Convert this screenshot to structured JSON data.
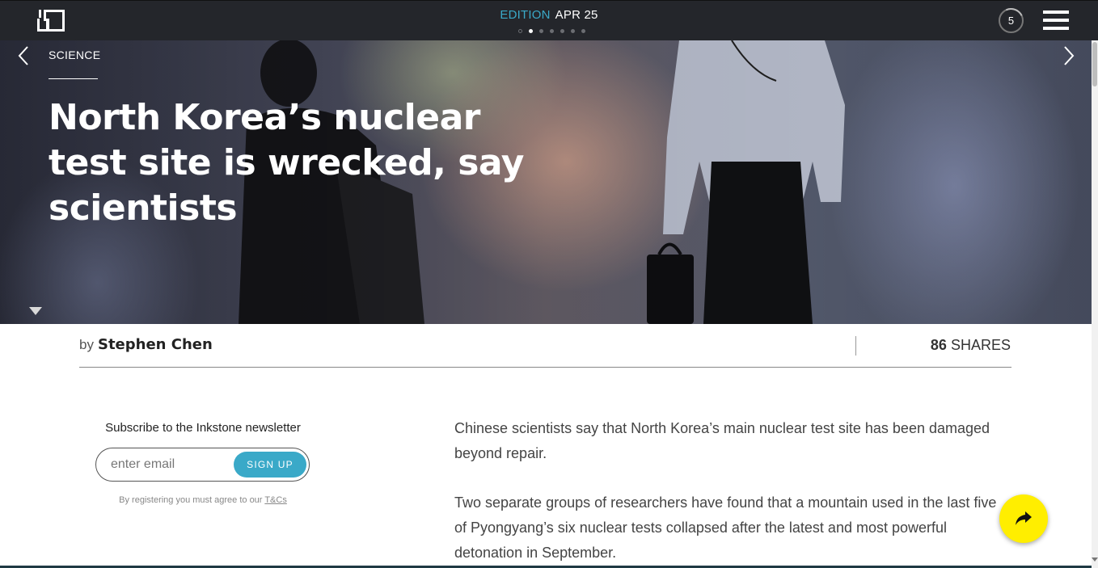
{
  "topbar": {
    "logo_icon": "inkstone-logo-icon",
    "edition_label": "EDITION",
    "edition_date": "APR 25",
    "pager_dots": 7,
    "pager_active": 2,
    "counter": "5",
    "menu_icon": "hamburger-menu-icon"
  },
  "hero": {
    "category": "SCIENCE",
    "headline": "North Korea’s nuclear test site is wrecked, say scientists",
    "prev_icon": "chevron-left-icon",
    "next_icon": "chevron-right-icon",
    "scroll_icon": "caret-down-icon"
  },
  "byline": {
    "by": "by",
    "author": "Stephen Chen",
    "shares_count": "86",
    "shares_label": "SHARES"
  },
  "newsletter": {
    "title": "Subscribe to the Inkstone newsletter",
    "placeholder": "enter email",
    "button_label": "SIGN UP",
    "note": "By registering you must agree to our",
    "terms_link": "T&Cs"
  },
  "article": {
    "paragraphs": [
      "Chinese scientists say that North Korea’s main nuclear test site has been damaged beyond repair.",
      "Two separate groups of researchers have found that a mountain used in the last five of Pyongyang’s six nuclear tests collapsed after the latest and most powerful detonation in September."
    ]
  },
  "share_fab": {
    "icon": "share-arrow-icon"
  },
  "colors": {
    "topbar": "#24262b",
    "accent": "#3aa9c8",
    "fab": "#ffee00"
  }
}
